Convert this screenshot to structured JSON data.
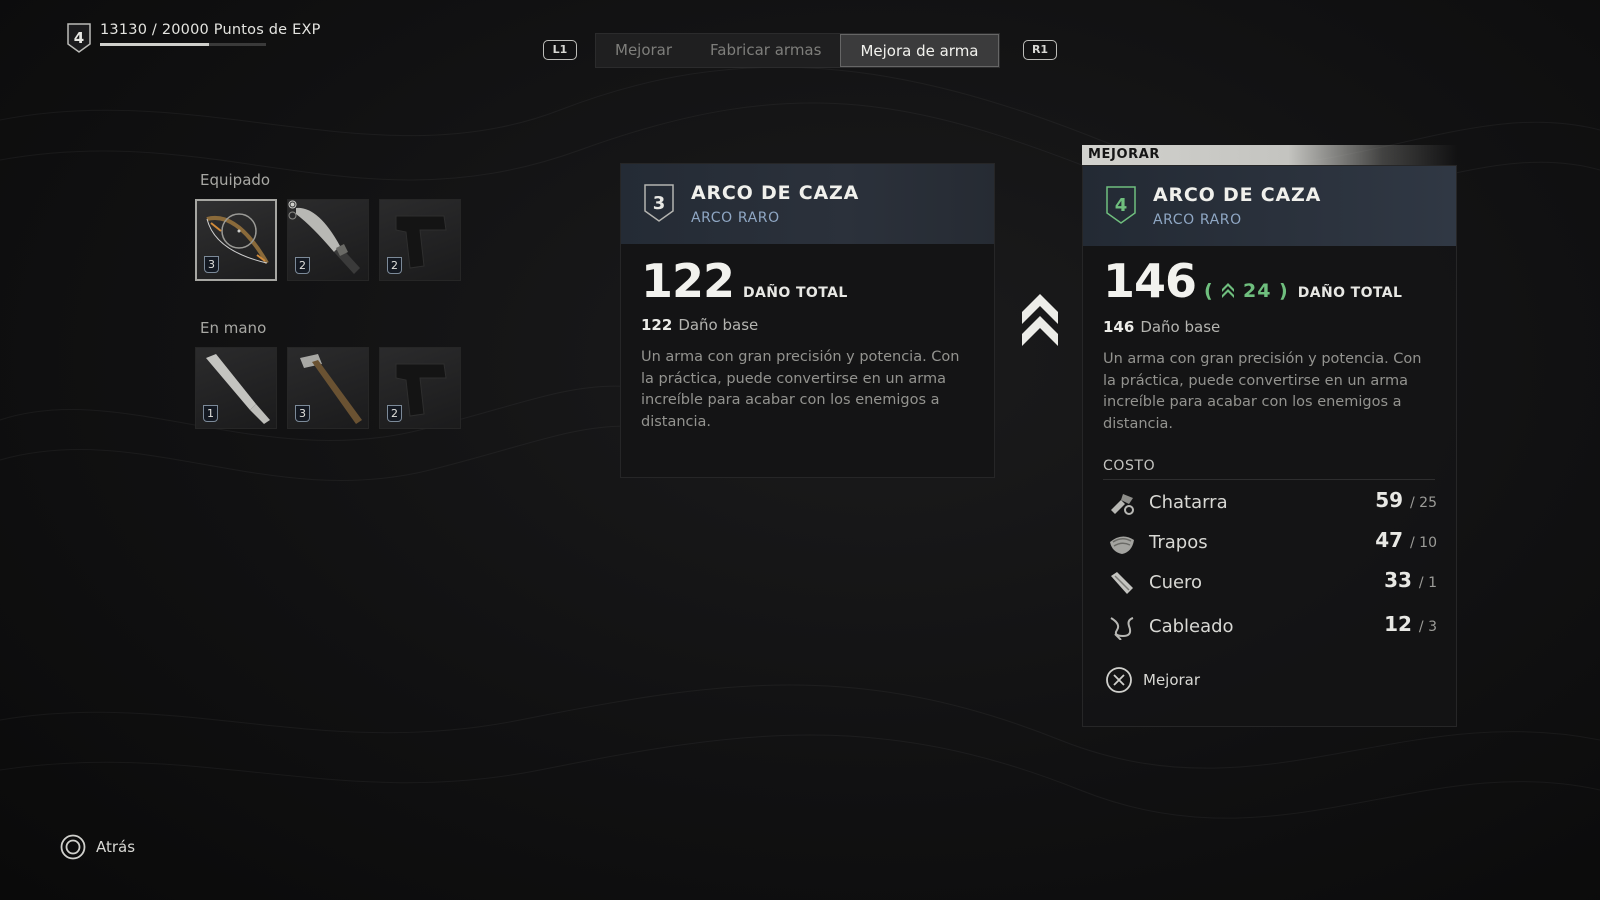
{
  "exp": {
    "level": "4",
    "current": "13130",
    "max": "20000",
    "label": "Puntos de EXP",
    "text": "13130 / 20000 Puntos de EXP",
    "progress": 0.6565
  },
  "nav": {
    "left_hint": "L1",
    "right_hint": "R1",
    "tabs": [
      {
        "label": "Mejorar",
        "active": false
      },
      {
        "label": "Fabricar armas",
        "active": false
      },
      {
        "label": "Mejora de arma",
        "active": true
      }
    ]
  },
  "inventory": {
    "equipped_label": "Equipado",
    "equipped": [
      {
        "icon": "bow-icon",
        "level": "3",
        "selected": true
      },
      {
        "icon": "machete-icon",
        "level": "2",
        "selected": false
      },
      {
        "icon": "pistol-icon",
        "level": "2",
        "selected": false
      }
    ],
    "in_hand_label": "En mano",
    "in_hand": [
      {
        "icon": "machete-icon",
        "level": "1"
      },
      {
        "icon": "hammer-icon",
        "level": "3"
      },
      {
        "icon": "pistol-icon",
        "level": "2"
      }
    ]
  },
  "current_weapon": {
    "level": "3",
    "name": "ARCO DE CAZA",
    "rarity": "ARCO RARO",
    "total_damage": "122",
    "total_damage_label": "DAÑO TOTAL",
    "base_damage": "122",
    "base_damage_label": "Daño base",
    "description": "Un arma con gran precisión y potencia. Con la práctica, puede convertirse en un arma increíble para acabar con los enemigos a distancia."
  },
  "upgrade": {
    "tag": "MEJORAR",
    "level": "4",
    "name": "ARCO DE CAZA",
    "rarity": "ARCO RARO",
    "total_damage": "146",
    "delta": "24",
    "total_damage_label": "DAÑO TOTAL",
    "base_damage": "146",
    "base_damage_label": "Daño base",
    "description": "Un arma con gran precisión y potencia. Con la práctica, puede convertirse en un arma increíble para acabar con los enemigos a distancia.",
    "cost_label": "COSTO",
    "costs": [
      {
        "name": "Chatarra",
        "have": "59",
        "need": "/ 25",
        "icon": "scrap-icon"
      },
      {
        "name": "Trapos",
        "have": "47",
        "need": "/ 10",
        "icon": "rags-icon"
      },
      {
        "name": "Cuero",
        "have": "33",
        "need": "/ 1",
        "icon": "leather-icon"
      },
      {
        "name": "Cableado",
        "have": "12",
        "need": "/ 3",
        "icon": "wiring-icon"
      }
    ],
    "action_label": "Mejorar"
  },
  "footer": {
    "back_label": "Atrás"
  },
  "colors": {
    "accent_green": "#6fbf7e",
    "rarity_blue": "#8fa7c4"
  }
}
